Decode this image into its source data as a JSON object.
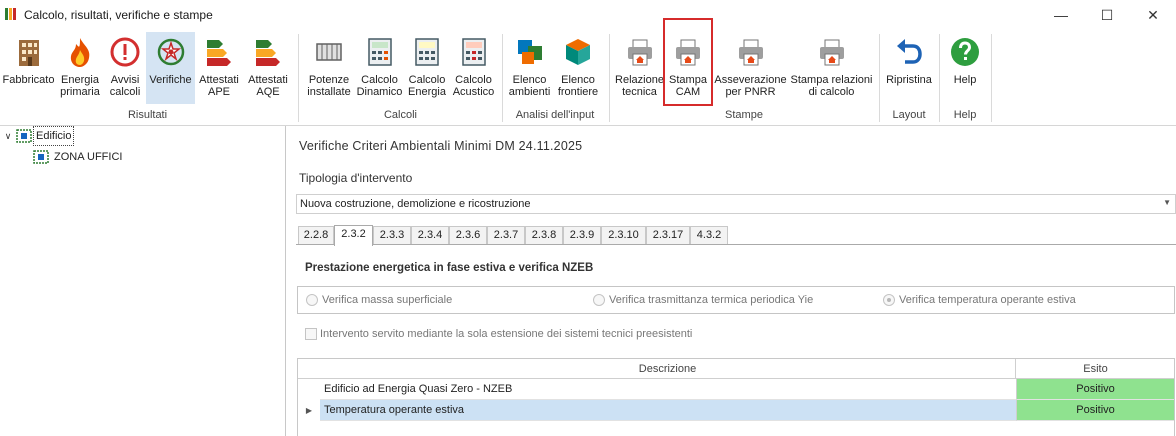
{
  "window": {
    "title": "Calcolo, risultati, verifiche e stampe",
    "controls": [
      "—",
      "☐",
      "✕"
    ]
  },
  "ribbon": {
    "buttons": [
      {
        "id": "fabbricato",
        "label": "Fabbricato",
        "icon": "building-icon"
      },
      {
        "id": "energia",
        "label": "Energia\nprimaria",
        "icon": "fire-icon"
      },
      {
        "id": "avvisi",
        "label": "Avvisi\ncalcoli",
        "icon": "warning-icon"
      },
      {
        "id": "verifiche",
        "label": "Verifiche",
        "icon": "emblem-icon"
      },
      {
        "id": "ape",
        "label": "Attestati\nAPE",
        "icon": "energy-class-icon"
      },
      {
        "id": "aqe",
        "label": "Attestati\nAQE",
        "icon": "energy-class-icon"
      },
      {
        "id": "potenze",
        "label": "Potenze\ninstallate",
        "icon": "radiator-icon"
      },
      {
        "id": "dinamico",
        "label": "Calcolo\nDinamico",
        "icon": "calculator-icon"
      },
      {
        "id": "energia_calc",
        "label": "Calcolo\nEnergia",
        "icon": "calculator-icon"
      },
      {
        "id": "acustico",
        "label": "Calcolo\nAcustico",
        "icon": "calculator-icon"
      },
      {
        "id": "ambienti",
        "label": "Elenco\nambienti",
        "icon": "rooms-icon"
      },
      {
        "id": "frontiere",
        "label": "Elenco\nfrontiere",
        "icon": "cube-icon"
      },
      {
        "id": "relazione",
        "label": "Relazione\ntecnica",
        "icon": "printer-icon"
      },
      {
        "id": "cam",
        "label": "Stampa\nCAM",
        "icon": "printer-icon"
      },
      {
        "id": "pnrr",
        "label": "Asseverazione\nper PNRR",
        "icon": "printer-icon"
      },
      {
        "id": "relazioni",
        "label": "Stampa relazioni\ndi calcolo",
        "icon": "printer-icon"
      },
      {
        "id": "ripristina",
        "label": "Ripristina",
        "icon": "undo-icon"
      },
      {
        "id": "help",
        "label": "Help",
        "icon": "help-icon"
      }
    ],
    "groups": [
      "Risultati",
      "Calcoli",
      "Analisi dell'input",
      "Stampe",
      "Layout",
      "Help"
    ],
    "active_button": "Verifiche",
    "highlighted_button": "Stampa CAM"
  },
  "tree": {
    "root": "Edificio",
    "children": [
      "ZONA UFFICI"
    ]
  },
  "main": {
    "heading": "Verifiche Criteri Ambientali Minimi DM 24.11.2025",
    "tipologia_label": "Tipologia d'intervento",
    "tipologia_value": "Nuova costruzione, demolizione e ricostruzione",
    "tabs": [
      "2.2.8",
      "2.3.2",
      "2.3.3",
      "2.3.4",
      "2.3.6",
      "2.3.7",
      "2.3.8",
      "2.3.9",
      "2.3.10",
      "2.3.17",
      "4.3.2"
    ],
    "active_tab": "2.3.2",
    "panel_title": "Prestazione energetica in fase estiva e verifica NZEB",
    "radios": [
      {
        "label": "Verifica massa superficiale",
        "checked": false
      },
      {
        "label": "Verifica trasmittanza termica periodica Yie",
        "checked": false
      },
      {
        "label": "Verifica temperatura operante estiva",
        "checked": true
      }
    ],
    "checkbox_label": "Intervento servito mediante la sola estensione dei sistemi tecnici preesistenti",
    "grid": {
      "columns": [
        "Descrizione",
        "Esito"
      ],
      "rows": [
        {
          "descrizione": "Edificio ad Energia Quasi Zero - NZEB",
          "esito": "Positivo"
        },
        {
          "descrizione": "Temperatura operante estiva",
          "esito": "Positivo"
        }
      ]
    }
  },
  "colors": {
    "positive": "#8fe28f",
    "selection": "#cce1f4",
    "highlight_border": "#d62b2b",
    "active_ribbon": "#d5e4f3"
  }
}
